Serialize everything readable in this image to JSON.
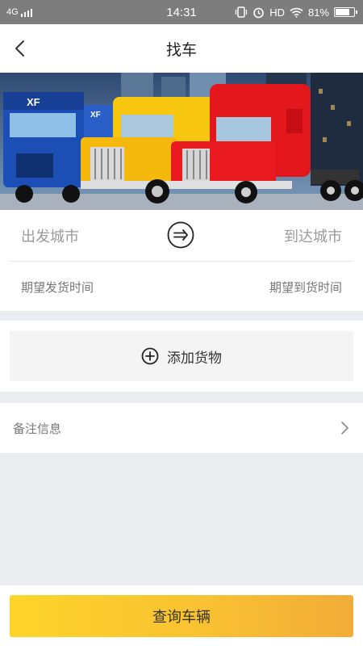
{
  "status_bar": {
    "network": "4G",
    "time": "14:31",
    "hd": "HD",
    "battery": "81%",
    "battery_level": 0.81
  },
  "nav": {
    "title": "找车"
  },
  "banner": {
    "truck_brand_1": "XF",
    "truck_brand_2": "XF",
    "sky_color": "#3d5d86"
  },
  "route": {
    "from_city_placeholder": "出发城市",
    "to_city_placeholder": "到达城市",
    "departure_time_placeholder": "期望发货时间",
    "arrival_time_placeholder": "期望到货时间"
  },
  "cargo": {
    "add_label": "添加货物"
  },
  "remark": {
    "label": "备注信息"
  },
  "bottom": {
    "query_label": "查询车辆"
  },
  "colors": {
    "accent_start": "#fed42a",
    "accent_end": "#f2ac39",
    "page_bg": "#ebedf0"
  }
}
